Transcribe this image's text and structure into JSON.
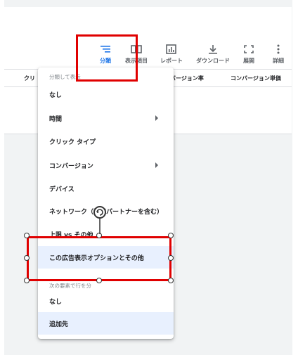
{
  "toolbar": {
    "items": [
      {
        "label": "分類",
        "icon": "segment-icon"
      },
      {
        "label": "表示項目",
        "icon": "columns-icon"
      },
      {
        "label": "レポート",
        "icon": "report-icon"
      },
      {
        "label": "ダウンロード",
        "icon": "download-icon"
      },
      {
        "label": "展開",
        "icon": "expand-icon"
      },
      {
        "label": "詳細",
        "icon": "more-vert-icon"
      }
    ]
  },
  "table": {
    "headers": [
      "クリ",
      "バージョン率",
      "コンバージョン単価"
    ]
  },
  "menu": {
    "section1": "分類して表示",
    "items": [
      {
        "label": "なし"
      },
      {
        "label": "時間"
      },
      {
        "label": "クリック タイプ"
      },
      {
        "label": "コンバージョン"
      },
      {
        "label": "デバイス"
      },
      {
        "label": "ネットワーク（検索パートナーを含む）"
      },
      {
        "label": "上限 vs その他"
      },
      {
        "label": "この広告表示オプションとその他"
      }
    ],
    "section2": "次の要素で行を分",
    "items2": [
      {
        "label": "なし"
      },
      {
        "label": "追加先"
      }
    ]
  },
  "colors": {
    "accent": "#1a73e8",
    "annotation": "#e00000",
    "highlight": "#e8f0fe"
  }
}
